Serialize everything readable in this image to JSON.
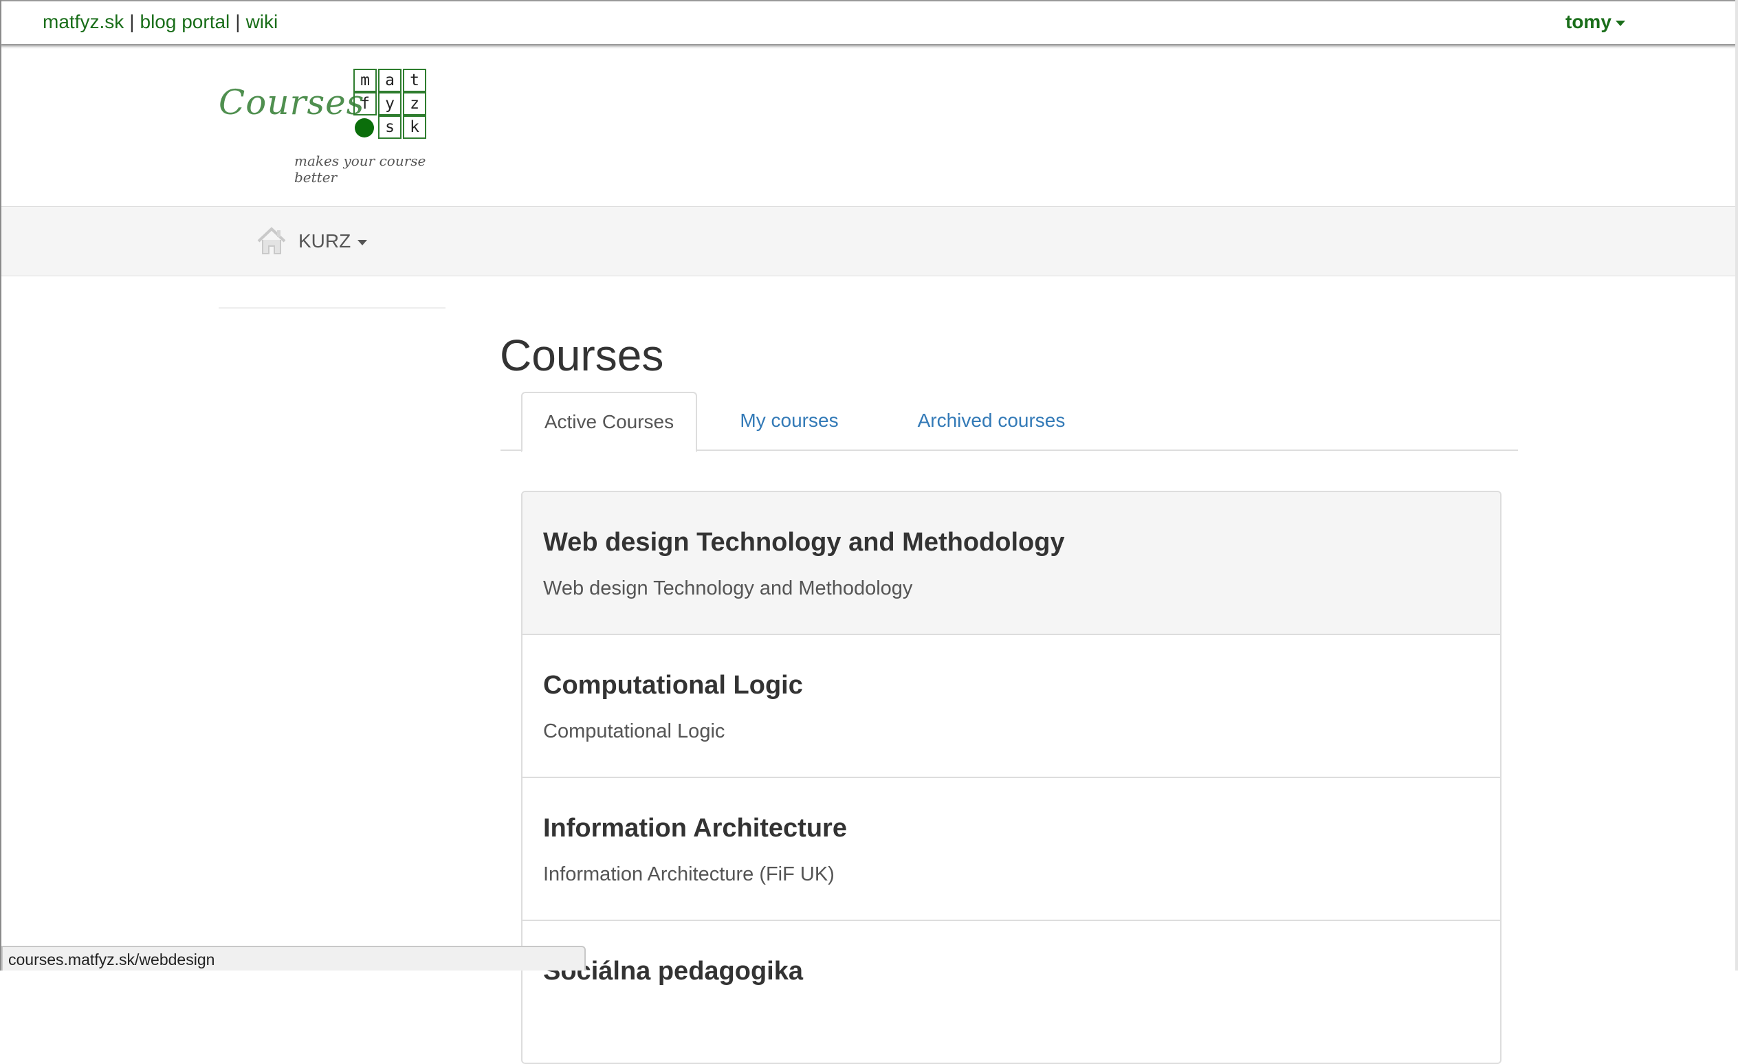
{
  "topbar": {
    "links": [
      "matfyz.sk",
      "blog portal",
      "wiki"
    ],
    "separator": "|",
    "user": "tomy"
  },
  "logo": {
    "word": "Courses",
    "grid_letters": [
      "m",
      "a",
      "t",
      "f",
      "y",
      "z",
      "s",
      "k"
    ],
    "tagline": "makes your course better",
    "color": "#2e7d2e"
  },
  "nav": {
    "home_icon": "home-icon",
    "menu_label": "KURZ"
  },
  "page": {
    "title": "Courses",
    "tabs": [
      {
        "label": "Active Courses",
        "active": true
      },
      {
        "label": "My courses",
        "active": false
      },
      {
        "label": "Archived courses",
        "active": false
      }
    ]
  },
  "courses": [
    {
      "title": "Web design Technology and Methodology",
      "description": "Web design Technology and Methodology"
    },
    {
      "title": "Computational Logic",
      "description": "Computational Logic"
    },
    {
      "title": "Information Architecture",
      "description": "Information Architecture (FiF UK)"
    },
    {
      "title": "Sociálna pedagogika",
      "description": ""
    }
  ],
  "status_bar": {
    "url": "courses.matfyz.sk/webdesign"
  },
  "colors": {
    "link_green": "#1a6e1a",
    "link_blue": "#337ab7",
    "navbar_bg": "#f5f5f5"
  }
}
